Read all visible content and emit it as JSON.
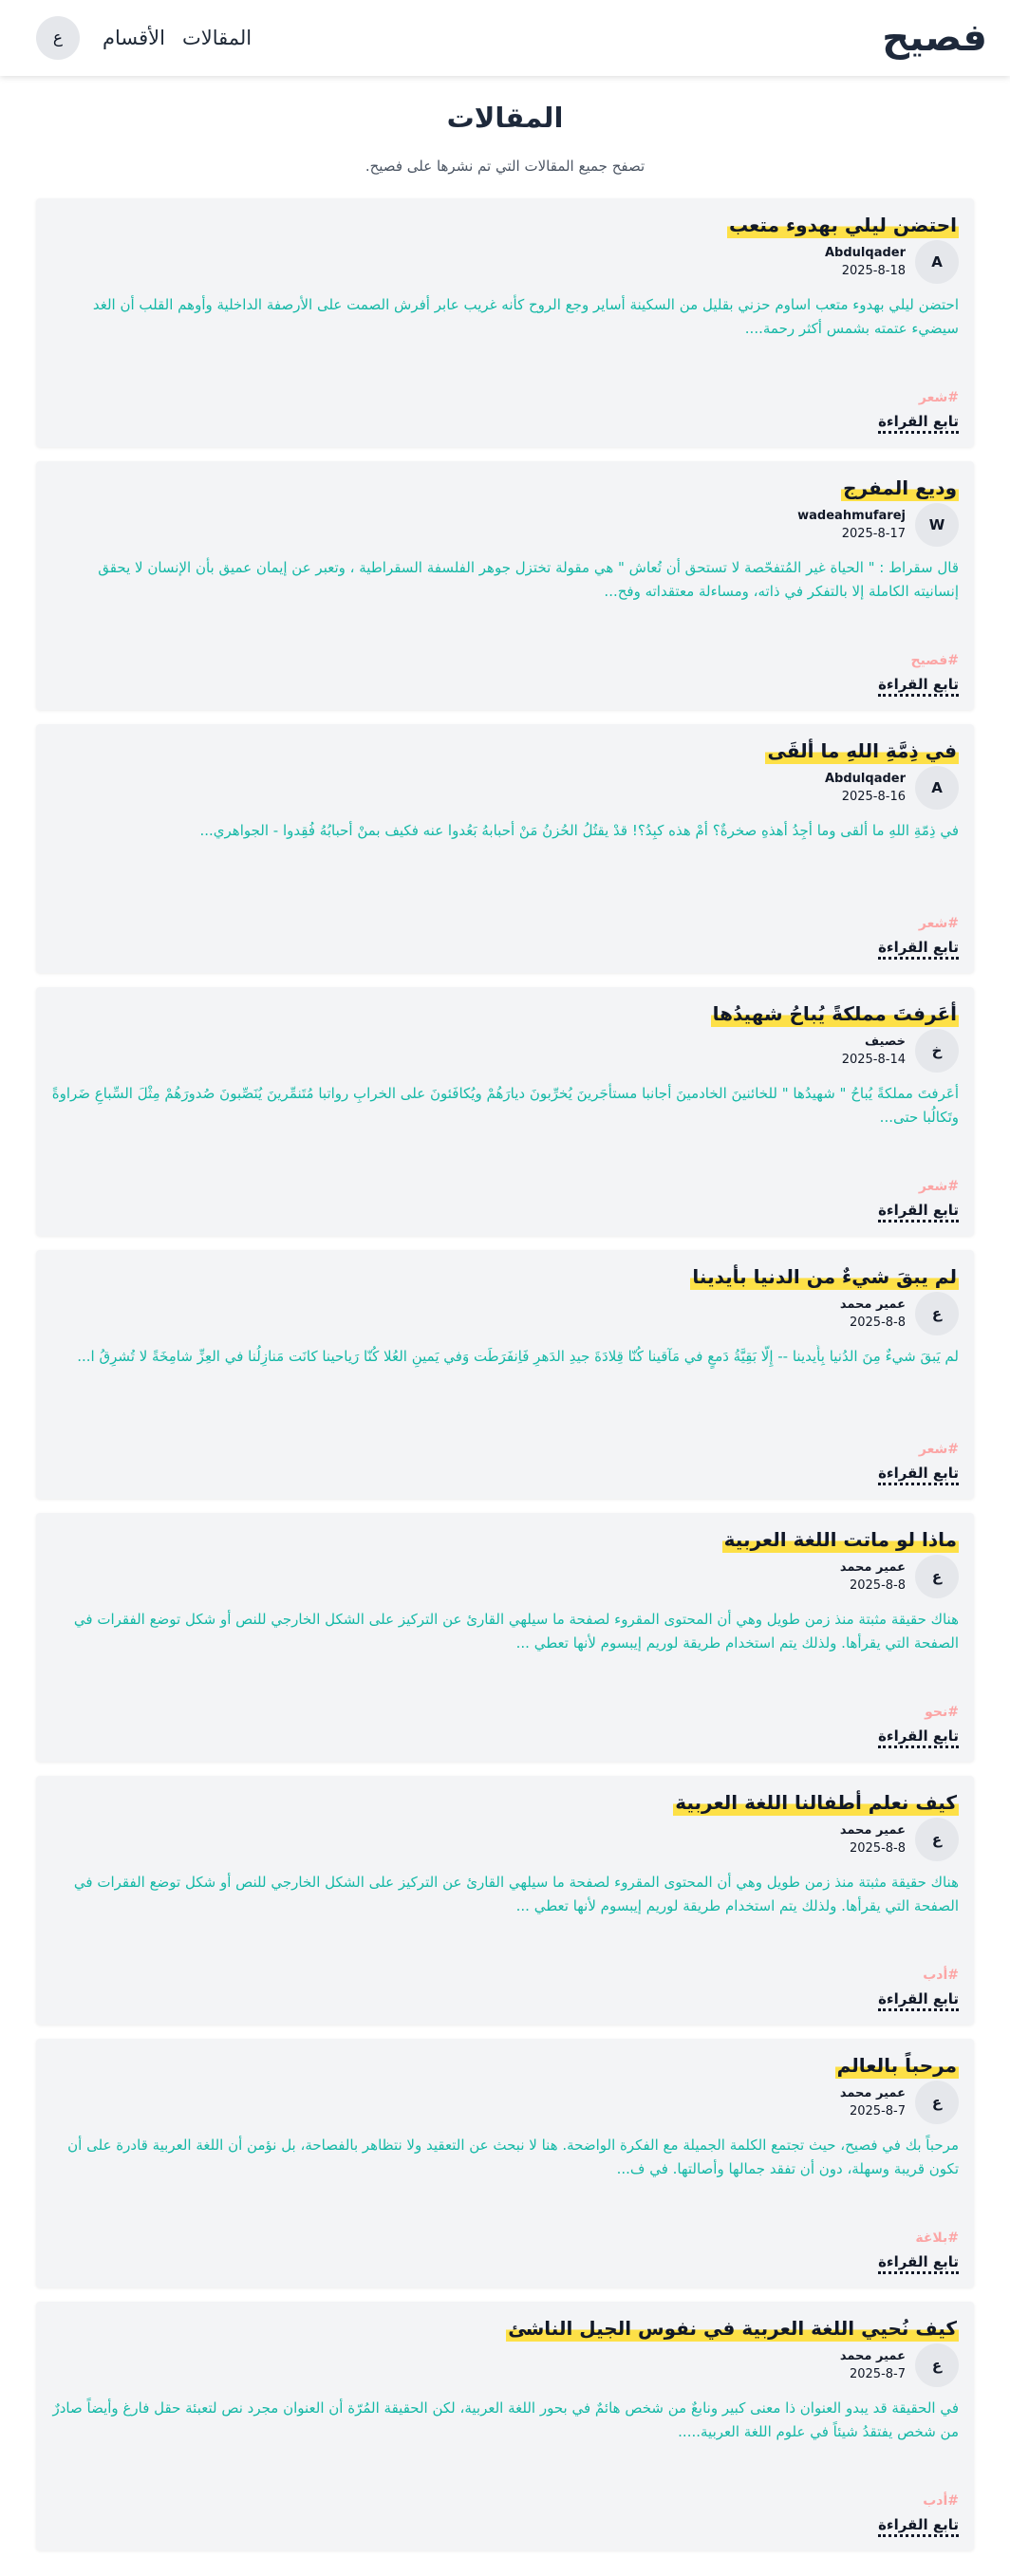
{
  "header": {
    "logo": "فصيح",
    "nav": [
      "المقالات",
      "الأقسام"
    ],
    "user_initial": "ع"
  },
  "page": {
    "title": "المقالات",
    "subtitle": "تصفح جميع المقالات التي تم نشرها على فصيح."
  },
  "read_more_label": "تابع القراءة",
  "colors": {
    "accent_highlight": "#fde047",
    "excerpt_text": "#14b8a6",
    "tag_text": "#fca5a5",
    "card_background": "#f3f4f6"
  },
  "posts": [
    {
      "title": "احتضن ليلي بهدوء متعب",
      "initial": "A",
      "author": "Abdulqader",
      "date": "2025-8-18",
      "excerpt": "احتضن ليلي بهدوء متعب اساوم حزني بقليل من السكينة أساير وجع الروح كأنه غريب عابر أفرش الصمت على الأرصفة الداخلية وأوهم القلب أن الغد سيضيء عتمته بشمس أكثر رحمة....",
      "tag": "#شعر"
    },
    {
      "title": "وديع المفرج",
      "initial": "W",
      "author": "wadeahmufarej",
      "date": "2025-8-17",
      "excerpt": "قال سقراط : \" الحياة غير المُتفحّصة لا تستحق أن تُعاش \" هي مقولة تختزل جوهر الفلسفة السقراطية ، وتعبر عن إيمان عميق بأن الإنسان لا يحقق إنسانيته الكاملة إلا بالتفكر في ذاته، ومساءلة معتقداته وفح...",
      "tag": "#فصيح"
    },
    {
      "title": "في ذِمَّةِ اللهِ ما ألقَى",
      "initial": "A",
      "author": "Abdulqader",
      "date": "2025-8-16",
      "excerpt": "في ذِمّةِ اللهِ ما ألقى وما أجِدُ أهذهِ صخرةٌ؟ أمْ هذه كبِدُ؟! قدْ يقتُلُ الحُزنُ مَنْ أحبابهُ بَعُدوا عنه فكيف بمنْ أحبابُهُ فُقِدوا - الجواهري...",
      "tag": "#شعر"
    },
    {
      "title": "أعَرفتَ مملكةً يُباحُ شهيدُها",
      "initial": "خ",
      "author": "خصيف",
      "date": "2025-8-14",
      "excerpt": "أعَرفتَ مملكةً يُباحُ \" شهيدُها \" للخائنينَ الخادمينَ أجانبا مستأجَرينَ يُخرِّبونَ ديارَهُمْ ويُكافَئونَ على الخرابِ رواتبا مُتَنمِّرينَ يُنَصِّبونَ صُدورَهُمْ مِثْلَ السِّباعِ ضَراوةً وتَكالُبا حتى...",
      "tag": "#شعر"
    },
    {
      "title": "لم يبقَ شيءٌ من الدنيا بأيدينا",
      "initial": "ع",
      "author": "عمير محمد",
      "date": "2025-8-8",
      "excerpt": "لم يَبقَ شيءٌ مِنَ الدُنيا بِأَيدينا -- إِلّا بَقِيَّةُ دَمعٍ في مَآقينا كُنّا قِلادَةَ جيدِ الدَهرِ فَاِنفَرَطَت وَفي يَمينِ العُلا كُنّا رَياحينا كانَت مَنازِلُنا في العِزِّ شامِخَةً لا تُشرِقُ ا...",
      "tag": "#شعر"
    },
    {
      "title": "ماذا لو ماتت اللغة العربية",
      "initial": "ع",
      "author": "عمير محمد",
      "date": "2025-8-8",
      "excerpt": "هناك حقيقة مثبتة منذ زمن طويل وهي أن المحتوى المقروء لصفحة ما سيلهي القارئ عن التركيز على الشكل الخارجي للنص أو شكل توضع الفقرات في الصفحة التي يقرأها. ولذلك يتم استخدام طريقة لوريم إيبسوم لأنها تعطي ...",
      "tag": "#نحو"
    },
    {
      "title": "كيف نعلم أطفالنا اللغة العربية",
      "initial": "ع",
      "author": "عمير محمد",
      "date": "2025-8-8",
      "excerpt": "هناك حقيقة مثبتة منذ زمن طويل وهي أن المحتوى المقروء لصفحة ما سيلهي القارئ عن التركيز على الشكل الخارجي للنص أو شكل توضع الفقرات في الصفحة التي يقرأها. ولذلك يتم استخدام طريقة لوريم إيبسوم لأنها تعطي ...",
      "tag": "#أدب"
    },
    {
      "title": "مرحباً بالعالم",
      "initial": "ع",
      "author": "عمير محمد",
      "date": "2025-8-7",
      "excerpt": "مرحباً بك في فصيح، حيث تجتمع الكلمة الجميلة مع الفكرة الواضحة. هنا لا نبحث عن التعقيد ولا نتظاهر بالفصاحة، بل نؤمن أن اللغة العربية قادرة على أن تكون قريبة وسهلة، دون أن تفقد جمالها وأصالتها. في ف...",
      "tag": "#بلاغة"
    },
    {
      "title": "كيف نُحيي اللغة العربية في نفوس الجيل الناشئ",
      "initial": "ع",
      "author": "عمير محمد",
      "date": "2025-8-7",
      "excerpt": "في الحقيقة قد يبدو العنوان ذا معنى كبير ونابعٌ من شخص هائمٌ في بحور اللغة العربية، لكن الحقيقة المُرّة أن العنوان مجرد نص لتعبئة حقل فارغ وأيضاً صادرٌ من شخص يفتقدُ شيئاً في علوم اللغة العربية.....",
      "tag": "#أدب"
    }
  ]
}
